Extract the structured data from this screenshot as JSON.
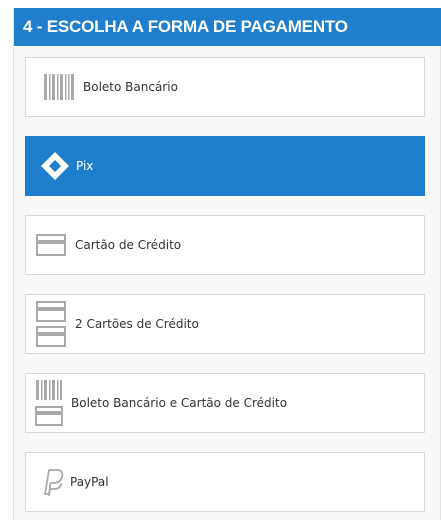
{
  "section": {
    "title": "4 - ESCOLHA A FORMA DE PAGAMENTO"
  },
  "payment_options": [
    {
      "label": "Boleto Bancário",
      "icon": "barcode-icon",
      "selected": false
    },
    {
      "label": "Pix",
      "icon": "pix-icon",
      "selected": true
    },
    {
      "label": "Cartão de Crédito",
      "icon": "credit-card-icon",
      "selected": false
    },
    {
      "label": "2 Cartões de Crédito",
      "icon": "two-credit-cards-icon",
      "selected": false
    },
    {
      "label": "Boleto Bancário e Cartão de Crédito",
      "icon": "barcode-and-card-icon",
      "selected": false
    },
    {
      "label": "PayPal",
      "icon": "paypal-icon",
      "selected": false
    }
  ],
  "colors": {
    "accent": "#1f7fcc",
    "icon_gray": "#a9a9a9",
    "text": "#333333"
  }
}
